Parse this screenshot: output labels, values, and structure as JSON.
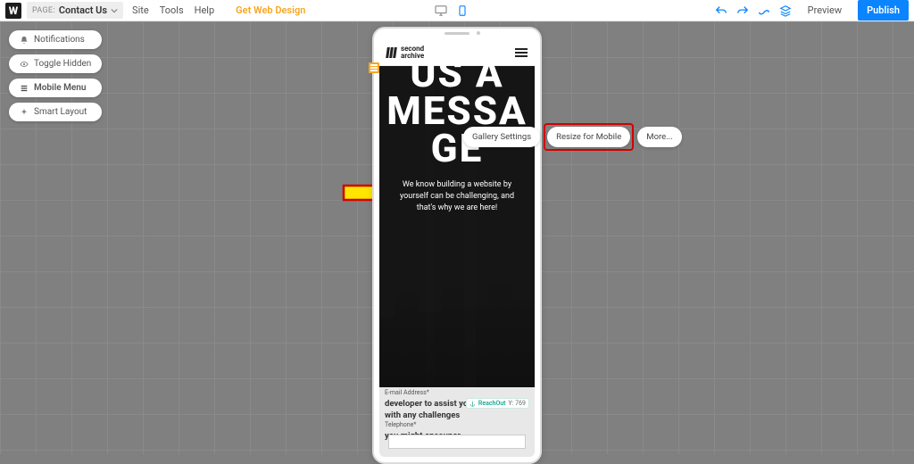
{
  "topbar": {
    "page_label": "PAGE:",
    "page_value": "Contact Us",
    "menu": {
      "site": "Site",
      "tools": "Tools",
      "help": "Help"
    },
    "cta": "Get Web Design",
    "preview": "Preview",
    "publish": "Publish"
  },
  "left_pills": {
    "notifications": "Notifications",
    "toggle_hidden": "Toggle Hidden",
    "mobile_menu": "Mobile Menu",
    "smart_layout": "Smart Layout"
  },
  "context_menu": {
    "gallery_settings": "Gallery Settings",
    "resize_mobile": "Resize for Mobile",
    "more": "More..."
  },
  "site": {
    "brand_line1": "second",
    "brand_line2": "archive",
    "drag_handle": "Drag Handle",
    "hero_title": "US A MESSAGE",
    "hero_sub": "We know building a website by yourself can be challenging, and that's why we are here!",
    "email_lbl": "E-mail Address*",
    "lower_1": "developer to assist you",
    "lower_2": "with any challenges",
    "tel_lbl": "Telephone*",
    "lower_3": "you might encouner",
    "link_name": "ReachOut",
    "link_coord": "Y: 769"
  }
}
